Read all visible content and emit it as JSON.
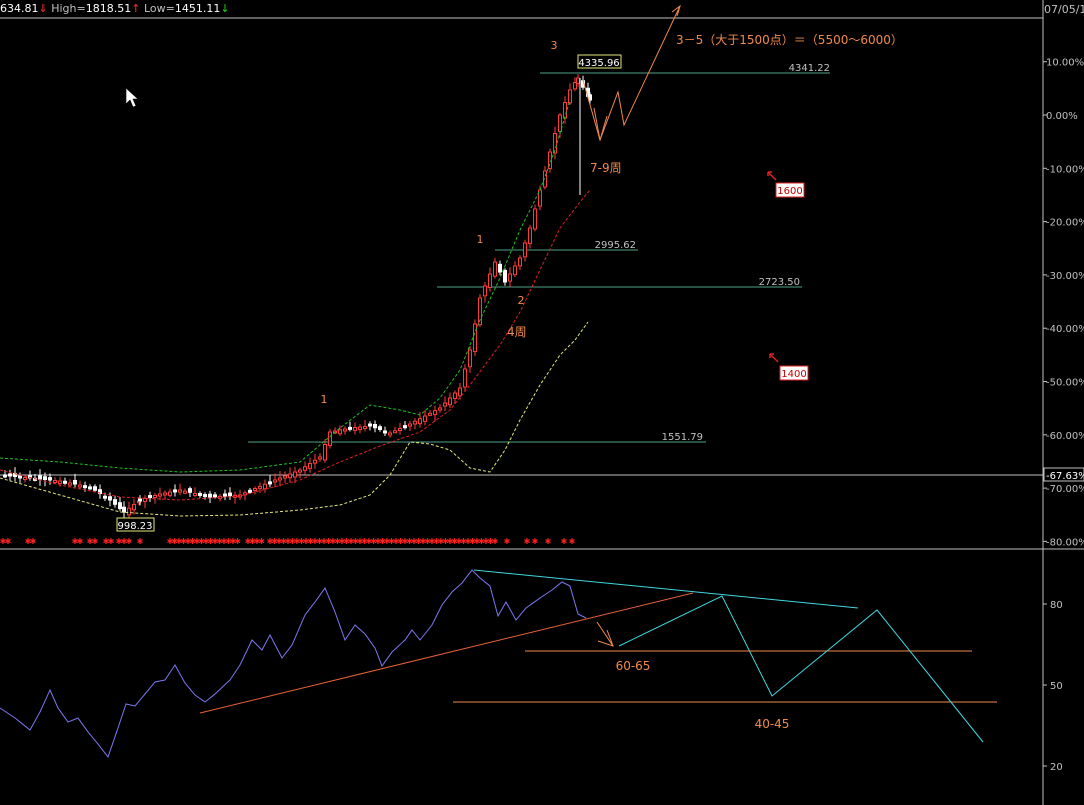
{
  "header": {
    "value": "634.81",
    "high_label": "High=",
    "high": "1818.51",
    "low_label": "Low=",
    "low": "1451.11",
    "date": "07/05/1"
  },
  "colors": {
    "background": "#000000",
    "axis": "#c0c0c0",
    "grid": "#808080",
    "candle_up": "#ff3a3a",
    "candle_down": "#ffffff",
    "ma_red": "#e02020",
    "band_green": "#20c020",
    "band_yellow": "#e6e67a",
    "annotation": "#f08a4b",
    "hline": "#4f9f8a",
    "rsi": "#7b78f0",
    "trend_upper": "#40d8e0",
    "trend_lower": "#e8603a",
    "stars": "#ff2020"
  },
  "chart_data": [
    {
      "type": "candlestick",
      "panel": "price",
      "y_axis_ticks": [
        "10.00%",
        "0.00%",
        "-10.00%",
        "-20.00%",
        "-30.00%",
        "-40.00%",
        "-50.00%",
        "-60.00%",
        "-70.00%",
        "-80.00%"
      ],
      "y_axis_values": [
        10,
        0,
        -10,
        -20,
        -30,
        -40,
        -50,
        -60,
        -70,
        -80
      ],
      "current_marker": "-67.63%",
      "ylim": [
        -80,
        10
      ],
      "low_point": "998.23",
      "high_point": "4335.96",
      "levels": [
        {
          "label": "4341.22"
        },
        {
          "label": "2995.62"
        },
        {
          "label": "2723.50"
        },
        {
          "label": "1551.79"
        }
      ],
      "wave_labels": [
        "1",
        "1",
        "2",
        "3"
      ],
      "annotations": {
        "target": "3－5（大于1500点）＝（5500～6000）",
        "weeks_a": "7-9周",
        "weeks_b": "4周",
        "box_a": "1600",
        "box_b": "1400"
      }
    },
    {
      "type": "line",
      "panel": "indicator",
      "y_axis_ticks": [
        "80",
        "50",
        "20"
      ],
      "y_axis_values": [
        80,
        50,
        20
      ],
      "annotations": {
        "zone_a": "60-65",
        "zone_b": "40-45"
      }
    }
  ]
}
